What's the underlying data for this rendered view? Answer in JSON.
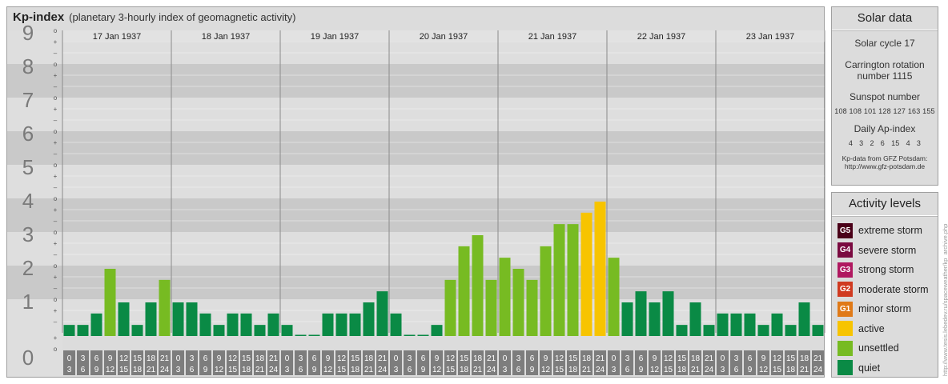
{
  "header": {
    "title": "Kp-index",
    "subtitle": "(planetary 3-hourly index of geomagnetic activity)"
  },
  "chart_data": {
    "type": "bar",
    "ylim": [
      0,
      9
    ],
    "y_ticks": [
      "0",
      "1",
      "2",
      "3",
      "4",
      "5",
      "6",
      "7",
      "8",
      "9"
    ],
    "sub_ticks": [
      "o",
      "+",
      "–"
    ],
    "days": [
      "17 Jan 1937",
      "18 Jan 1937",
      "19 Jan 1937",
      "20 Jan 1937",
      "21 Jan 1937",
      "22 Jan 1937",
      "23 Jan 1937"
    ],
    "interval_labels": [
      [
        "0",
        "3"
      ],
      [
        "3",
        "6"
      ],
      [
        "6",
        "9"
      ],
      [
        "9",
        "12"
      ],
      [
        "12",
        "15"
      ],
      [
        "15",
        "18"
      ],
      [
        "18",
        "21"
      ],
      [
        "21",
        "24"
      ]
    ],
    "values": [
      [
        0.33,
        0.33,
        0.67,
        2.0,
        1.0,
        0.33,
        1.0,
        1.67
      ],
      [
        1.0,
        1.0,
        0.67,
        0.33,
        0.67,
        0.67,
        0.33,
        0.67
      ],
      [
        0.33,
        0.0,
        0.0,
        0.67,
        0.67,
        0.67,
        1.0,
        1.33
      ],
      [
        0.67,
        0.0,
        0.0,
        0.33,
        1.67,
        2.67,
        3.0,
        1.67
      ],
      [
        2.33,
        2.0,
        1.67,
        2.67,
        3.33,
        3.33,
        3.67,
        4.0
      ],
      [
        2.33,
        1.0,
        1.33,
        1.0,
        1.33,
        0.33,
        1.0,
        0.33
      ],
      [
        0.67,
        0.67,
        0.67,
        0.33,
        0.67,
        0.33,
        1.0,
        0.33
      ]
    ],
    "colors": {
      "quiet": "#0a8a45",
      "unsettled": "#77bb22",
      "active": "#f7c400"
    },
    "thresholds": {
      "unsettled": 1.5,
      "active": 3.5
    }
  },
  "solar": {
    "title": "Solar data",
    "cycle": "Solar cycle 17",
    "carrington_1": "Carrington rotation",
    "carrington_2": "number 1115",
    "sunspot_label": "Sunspot number",
    "sunspot_values": "108 108 101 128 127 163 155",
    "ap_label": "Daily Ap-index",
    "ap_values": "4   3   2   6   15   4   3",
    "credit_1": "Kp-data from GFZ Potsdam:",
    "credit_2": "http://www.gfz-potsdam.de"
  },
  "activity": {
    "title": "Activity levels",
    "items": [
      {
        "code": "G5",
        "label": "extreme storm",
        "color": "#4a0018"
      },
      {
        "code": "G4",
        "label": "severe storm",
        "color": "#7a0a40"
      },
      {
        "code": "G3",
        "label": "strong storm",
        "color": "#b01860"
      },
      {
        "code": "G2",
        "label": "moderate storm",
        "color": "#d03a20"
      },
      {
        "code": "G1",
        "label": "minor storm",
        "color": "#e07a18"
      },
      {
        "code": "",
        "label": "active",
        "color": "#f7c400"
      },
      {
        "code": "",
        "label": "unsettled",
        "color": "#77bb22"
      },
      {
        "code": "",
        "label": "quiet",
        "color": "#0a8a45"
      }
    ]
  },
  "side_credit": "http://www.tesis.lebedev.ru/spaceweather/kp_archive.php"
}
